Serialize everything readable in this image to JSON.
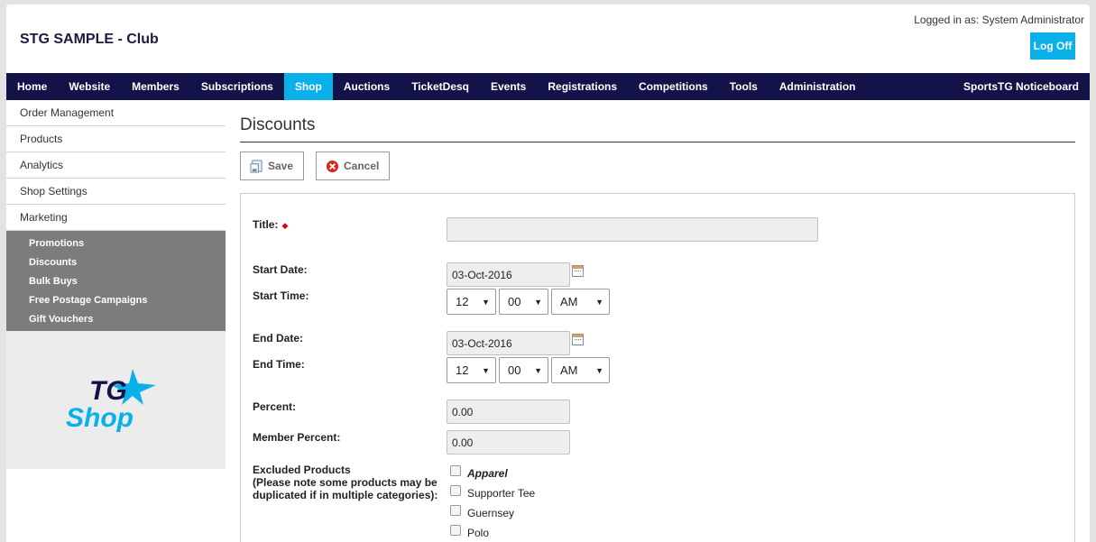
{
  "header": {
    "club_name": "STG SAMPLE - Club",
    "logged_in": "Logged in as: System Administrator",
    "logoff": "Log Off"
  },
  "nav": {
    "items": [
      "Home",
      "Website",
      "Members",
      "Subscriptions",
      "Shop",
      "Auctions",
      "TicketDesq",
      "Events",
      "Registrations",
      "Competitions",
      "Tools",
      "Administration"
    ],
    "active": "Shop",
    "right": "SportsTG Noticeboard"
  },
  "sidebar": {
    "items": [
      "Order Management",
      "Products",
      "Analytics",
      "Shop Settings",
      "Marketing"
    ],
    "subitems": [
      "Promotions",
      "Discounts",
      "Bulk Buys",
      "Free Postage Campaigns",
      "Gift Vouchers"
    ],
    "logo": {
      "line1": "TG",
      "line2": "Shop"
    }
  },
  "page": {
    "title": "Discounts",
    "save": "Save",
    "cancel": "Cancel"
  },
  "form": {
    "title_label": "Title:",
    "title_value": "",
    "start_date_label": "Start Date:",
    "start_date": "03-Oct-2016",
    "start_time_label": "Start Time:",
    "start_hour": "12",
    "start_min": "00",
    "start_ampm": "AM",
    "end_date_label": "End Date:",
    "end_date": "03-Oct-2016",
    "end_time_label": "End Time:",
    "end_hour": "12",
    "end_min": "00",
    "end_ampm": "AM",
    "percent_label": "Percent:",
    "percent": "0.00",
    "member_percent_label": "Member Percent:",
    "member_percent": "0.00",
    "excluded_label_1": "Excluded Products",
    "excluded_label_2": "(Please note some products may be",
    "excluded_label_3": "duplicated if in multiple categories):",
    "products": [
      "Apparel",
      "Supporter Tee",
      "Guernsey",
      "Polo"
    ]
  },
  "colors": {
    "nav_bg": "#13134a",
    "accent": "#0ab0ea"
  }
}
